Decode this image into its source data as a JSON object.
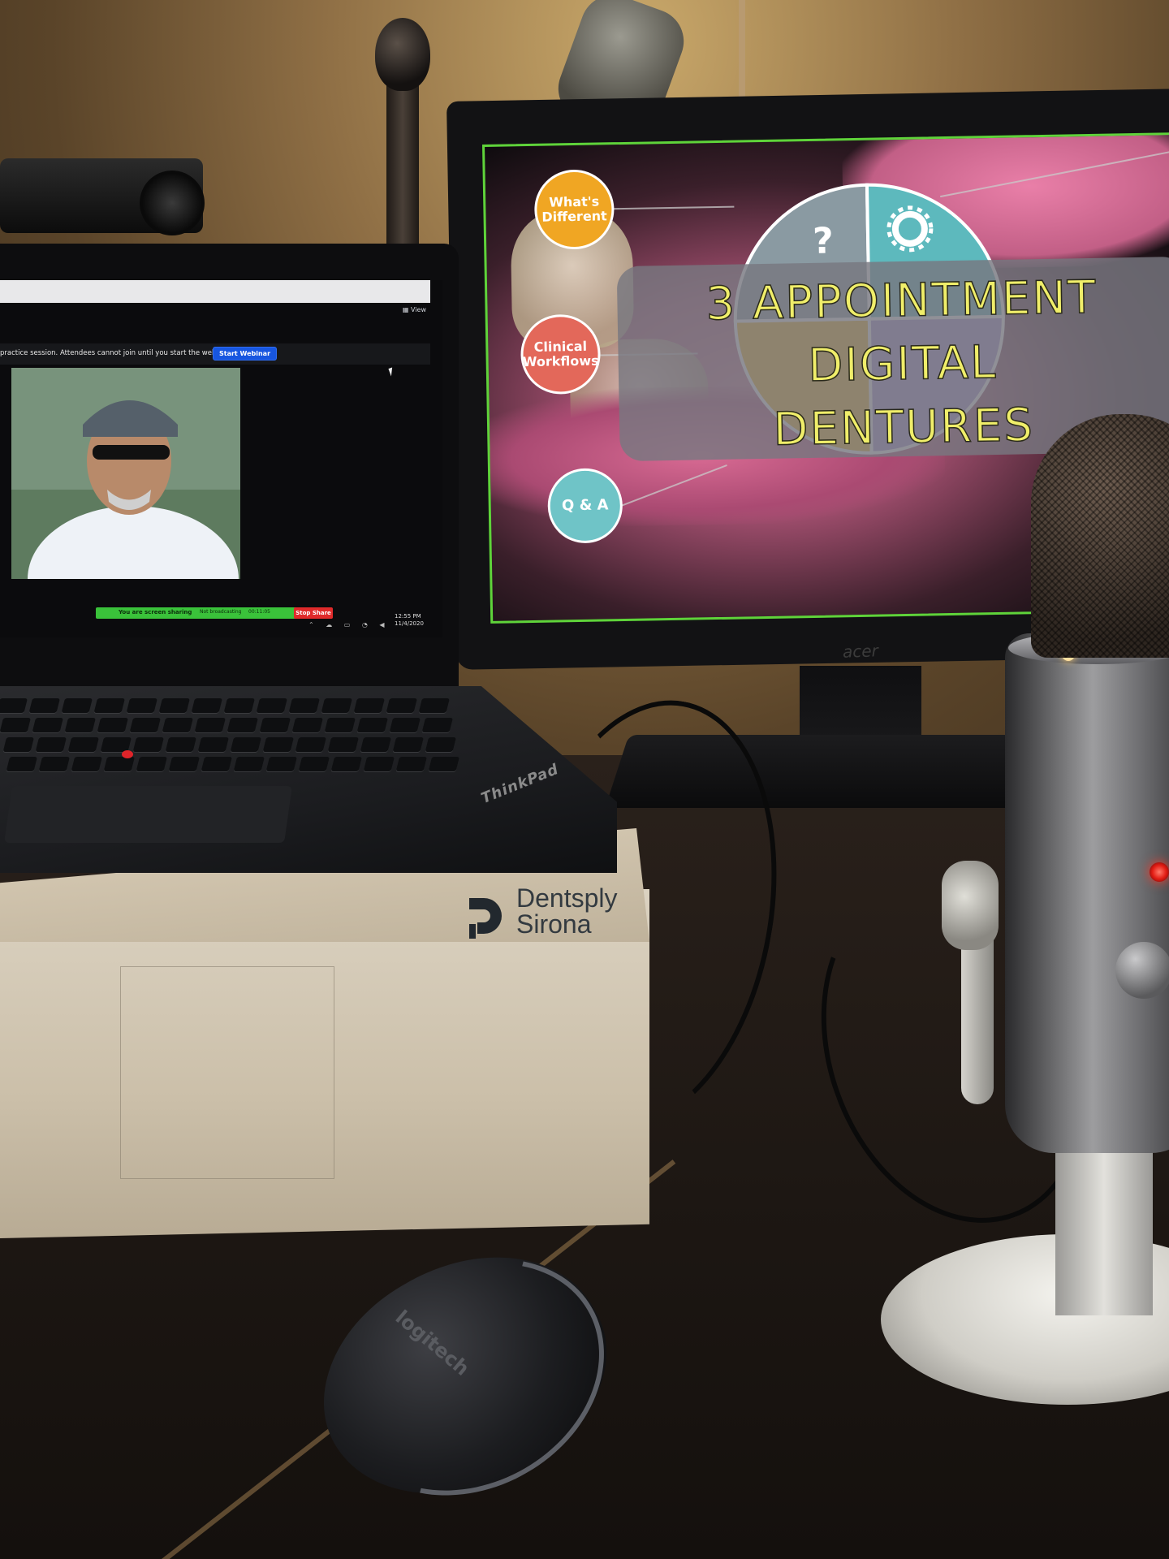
{
  "laptop": {
    "zoom_view_label": "View",
    "notice_text": "practice session. Attendees cannot join until you start the webinar.",
    "start_webinar_label": "Start Webinar",
    "share_bar_text": "You are screen sharing",
    "share_bar_status": "Not broadcasting",
    "share_bar_timer": "00:11:05",
    "stop_share_label": "Stop Share",
    "clock_time": "12:55 PM",
    "clock_date": "11/4/2020",
    "brand_label": "ThinkPad"
  },
  "box": {
    "brand_line1": "Dentsply",
    "brand_line2": "Sirona"
  },
  "monitor": {
    "brand_label": "acer",
    "slide": {
      "bubble_different": "What's Different",
      "bubble_workflows": "Clinical Workflows",
      "bubble_qa": "Q & A",
      "title_line1": "3 APPOINTMENT",
      "title_line2": "DIGITAL",
      "title_line3": "DENTURES",
      "wheel_colors": [
        "#f1b51c",
        "#8a9aa2",
        "#5db9bd",
        "#a58fd0"
      ]
    }
  },
  "mouse": {
    "brand_label": "logitech"
  }
}
